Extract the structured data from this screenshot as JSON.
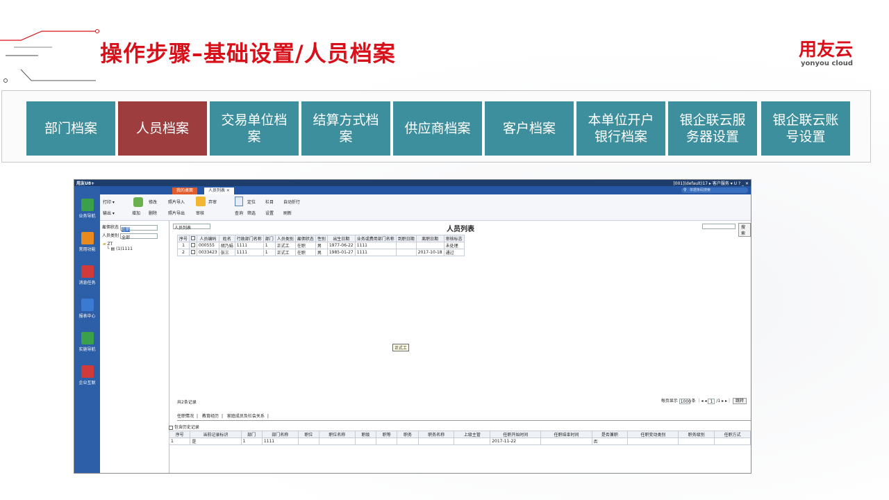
{
  "slide": {
    "title": "操作步骤–基础设置/人员档案"
  },
  "logo": {
    "cn": "用友云",
    "en": "yonyou cloud"
  },
  "nav_tabs": [
    {
      "label": "部门档案",
      "active": false
    },
    {
      "label": "人员档案",
      "active": true
    },
    {
      "label": "交易单位档案",
      "active": false
    },
    {
      "label": "结算方式档案",
      "active": false
    },
    {
      "label": "供应商档案",
      "active": false
    },
    {
      "label": "客户档案",
      "active": false
    },
    {
      "label": "本单位开户银行档案",
      "active": false
    },
    {
      "label": "银企联云服务器设置",
      "active": false
    },
    {
      "label": "银企联云账号设置",
      "active": false
    }
  ],
  "colors": {
    "accent_red": "#d8101a",
    "tab_teal": "#3e8f9d",
    "tab_active": "#9e3d3d"
  },
  "app": {
    "brand": "用友U8+",
    "status": "[001](default)17 ▸ 客户服务 ▾ U ? _ ✕",
    "search_placeholder": "单据条码搜索",
    "tabs": [
      "我的桌面",
      "人员列表 ×"
    ],
    "side_items": [
      {
        "label": "业务导航",
        "icon": "grid-icon",
        "color": "#3aa04a"
      },
      {
        "label": "常用功能",
        "icon": "star-icon",
        "color": "#e88a1e"
      },
      {
        "label": "消息任务",
        "icon": "calendar-icon",
        "color": "#d03a3a"
      },
      {
        "label": "报表中心",
        "icon": "chart-icon",
        "color": "#3a7ad0"
      },
      {
        "label": "实施导航",
        "icon": "compass-icon",
        "color": "#3aa04a"
      },
      {
        "label": "企业互联",
        "icon": "connect-icon",
        "color": "#d03a3a"
      }
    ],
    "toolbar": {
      "print": "打印 ▾",
      "export": "输出 ▾",
      "add": "增加",
      "edit": "修改",
      "delete": "删除",
      "photo_import": "照片导入",
      "photo_export": "照片导出",
      "submit": "弃审",
      "audit": "审核",
      "query": "查询",
      "locate": "定位",
      "filter": "筛选",
      "columns": "栏目",
      "settings": "设置",
      "autowrap": "自动折行",
      "refresh": "刷新"
    },
    "filters": {
      "status_label": "雇佣状态",
      "status_value": "在职",
      "type_label": "人员类别",
      "type_value": "全部"
    },
    "tree": {
      "root": "ZT",
      "child": "(1)1111"
    },
    "list_selector": "人员列表",
    "list_title": "人员列表",
    "search_button": "搜索",
    "table": {
      "headers": [
        "序号",
        "",
        "人员编码",
        "姓名",
        "行政部门名称",
        "部门",
        "人员类别",
        "雇佣状态",
        "性别",
        "出生日期",
        "业务或费用部门名称",
        "到职日期",
        "离职日期",
        "审核标志"
      ],
      "rows": [
        [
          "1",
          "",
          "000555",
          "胡乃娟",
          "1111",
          "1",
          "正式工",
          "在职",
          "男",
          "1977-06-22",
          "1111",
          "",
          "",
          "未处理"
        ],
        [
          "2",
          "",
          "0033423",
          "张三",
          "1111",
          "1",
          "正式工",
          "在职",
          "男",
          "1985-01-27",
          "1111",
          "",
          "2017-10-18",
          "通过"
        ]
      ]
    },
    "tooltip": "正式工",
    "footer": {
      "count": "共2条记录",
      "per_page_label": "每页显示",
      "per_page": "1000",
      "unit": "条",
      "page": "1",
      "of": "/1",
      "jump": "跳转"
    },
    "detail_tabs": [
      "任职情况",
      "教育经历",
      "家庭成员及社会关系"
    ],
    "include_history": "包含历史记录",
    "detail_table": {
      "headers": [
        "序号",
        "当前记录标识",
        "部门",
        "部门名称",
        "职位",
        "职位名称",
        "职级",
        "职等",
        "职务",
        "职务名称",
        "上级主管",
        "任职开始时间",
        "任职结束时间",
        "是否兼职",
        "任职变动类别",
        "职务级别",
        "任职方式"
      ],
      "rows": [
        [
          "1",
          "是",
          "1",
          "1111",
          "",
          "",
          "",
          "",
          "",
          "",
          "",
          "2017-11-22",
          "",
          "否",
          "",
          "",
          ""
        ]
      ]
    }
  }
}
